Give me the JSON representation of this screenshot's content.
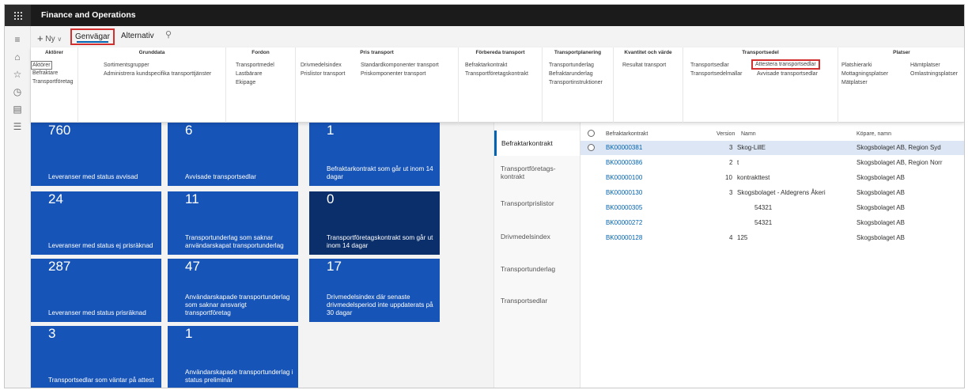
{
  "app": {
    "title": "Finance and Operations"
  },
  "actions": {
    "new_label": "Ny",
    "tab_shortcuts": "Genvägar",
    "tab_alternatives": "Alternativ"
  },
  "ribbon": {
    "groups": [
      {
        "title": "Aktörer",
        "items": [
          "Aktörer",
          "Befraktare",
          "Transportföretag"
        ]
      },
      {
        "title": "Grunddata",
        "items": [
          "Sortimentsgrupper",
          "Administrera kundspecifika transporttjänster"
        ]
      },
      {
        "title": "Fordon",
        "items": [
          "Transportmedel",
          "Lastbärare",
          "Ekipage"
        ]
      },
      {
        "title": "Pris transport",
        "items": [
          "Drivmedelsindex",
          "Standardkomponenter transport",
          "Prislistor transport",
          "Priskomponenter transport"
        ]
      },
      {
        "title": "Förbereda transport",
        "items": [
          "Befraktarkontrakt",
          "Transportföretagskontrakt"
        ]
      },
      {
        "title": "Transportplanering",
        "items": [
          "Transportunderlag",
          "Befraktarunderlag",
          "Transportinstruktioner"
        ]
      },
      {
        "title": "Kvantitet och värde",
        "items": [
          "Resultat transport"
        ]
      },
      {
        "title": "Transportsedel",
        "items": [
          "Transportsedlar",
          "Attestera transportsedlar",
          "Transportsedelmallar",
          "Avvisade transportsedlar"
        ]
      },
      {
        "title": "Platser",
        "items": [
          "Platshierarki",
          "Hämtplatser",
          "Mottagningsplatser",
          "Omlastningsplatser",
          "Mätplatser"
        ]
      }
    ]
  },
  "tiles": [
    {
      "value": "760",
      "label": "Leveranser med status avvisad"
    },
    {
      "value": "6",
      "label": "Avvisade transportsedlar"
    },
    {
      "value": "1",
      "label": "Befraktarkontrakt som går ut inom 14 dagar"
    },
    {
      "value": "24",
      "label": "Leveranser med status ej prisräknad"
    },
    {
      "value": "11",
      "label": "Transportunderlag som saknar användarskapat transportunderlag"
    },
    {
      "value": "0",
      "label": "Transportföretagskontrakt som går ut inom 14 dagar"
    },
    {
      "value": "287",
      "label": "Leveranser med status prisräknad"
    },
    {
      "value": "47",
      "label": "Användarskapade transportunderlag som saknar ansvarigt transportföretag"
    },
    {
      "value": "17",
      "label": "Drivmedelsindex där senaste drivmedelsperiod inte uppdaterats på 30 dagar"
    },
    {
      "value": "3",
      "label": "Transportsedlar som väntar på attest"
    },
    {
      "value": "1",
      "label": "Användarskapade transportunderlag i status preliminär"
    }
  ],
  "vtabs": [
    "Befraktarkontrakt",
    "Transportföretags-kontrakt",
    "Transportprislistor",
    "Drivmedelsindex",
    "Transportunderlag",
    "Transportsedlar"
  ],
  "grid": {
    "headers": [
      "Befraktarkontrakt",
      "Version",
      "Namn",
      "Köpare, namn"
    ],
    "rows": [
      {
        "id": "BK00000381",
        "version": "3",
        "name": "Skog-LillE",
        "buyer": "Skogsbolaget AB, Region Syd"
      },
      {
        "id": "BK00000386",
        "version": "2",
        "name": "t",
        "buyer": "Skogsbolaget AB, Region Norr"
      },
      {
        "id": "BK00000100",
        "version": "10",
        "name": "kontrakttest",
        "buyer": "Skogsbolaget AB"
      },
      {
        "id": "BK00000130",
        "version": "3",
        "name": "Skogsbolaget - Aldegrens Åkeri",
        "buyer": "Skogsbolaget AB"
      },
      {
        "id": "BK00000305",
        "version": "",
        "name": "54321",
        "buyer": "Skogsbolaget AB"
      },
      {
        "id": "BK00000272",
        "version": "",
        "name": "54321",
        "buyer": "Skogsbolaget AB"
      },
      {
        "id": "BK00000128",
        "version": "4",
        "name": "125",
        "buyer": "Skogsbolaget AB"
      }
    ]
  }
}
